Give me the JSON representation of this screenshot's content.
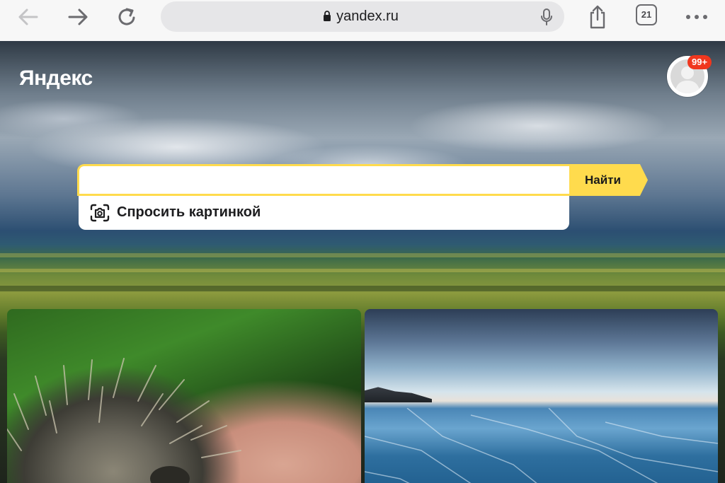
{
  "browser": {
    "url": "yandex.ru",
    "tab_count": "21",
    "icons": {
      "back": "back-arrow-icon",
      "forward": "forward-arrow-icon",
      "reload": "reload-icon",
      "lock": "lock-icon",
      "mic": "microphone-icon",
      "share": "share-icon",
      "tabs": "tabs-icon",
      "more": "more-icon"
    }
  },
  "page": {
    "logo": "Яндекс",
    "notifications_badge": "99+",
    "search": {
      "value": "",
      "placeholder": "",
      "button_label": "Найти",
      "suggestion_label": "Спросить картинкой"
    },
    "colors": {
      "accent": "#ffdb4d",
      "badge": "#f0371e"
    }
  }
}
